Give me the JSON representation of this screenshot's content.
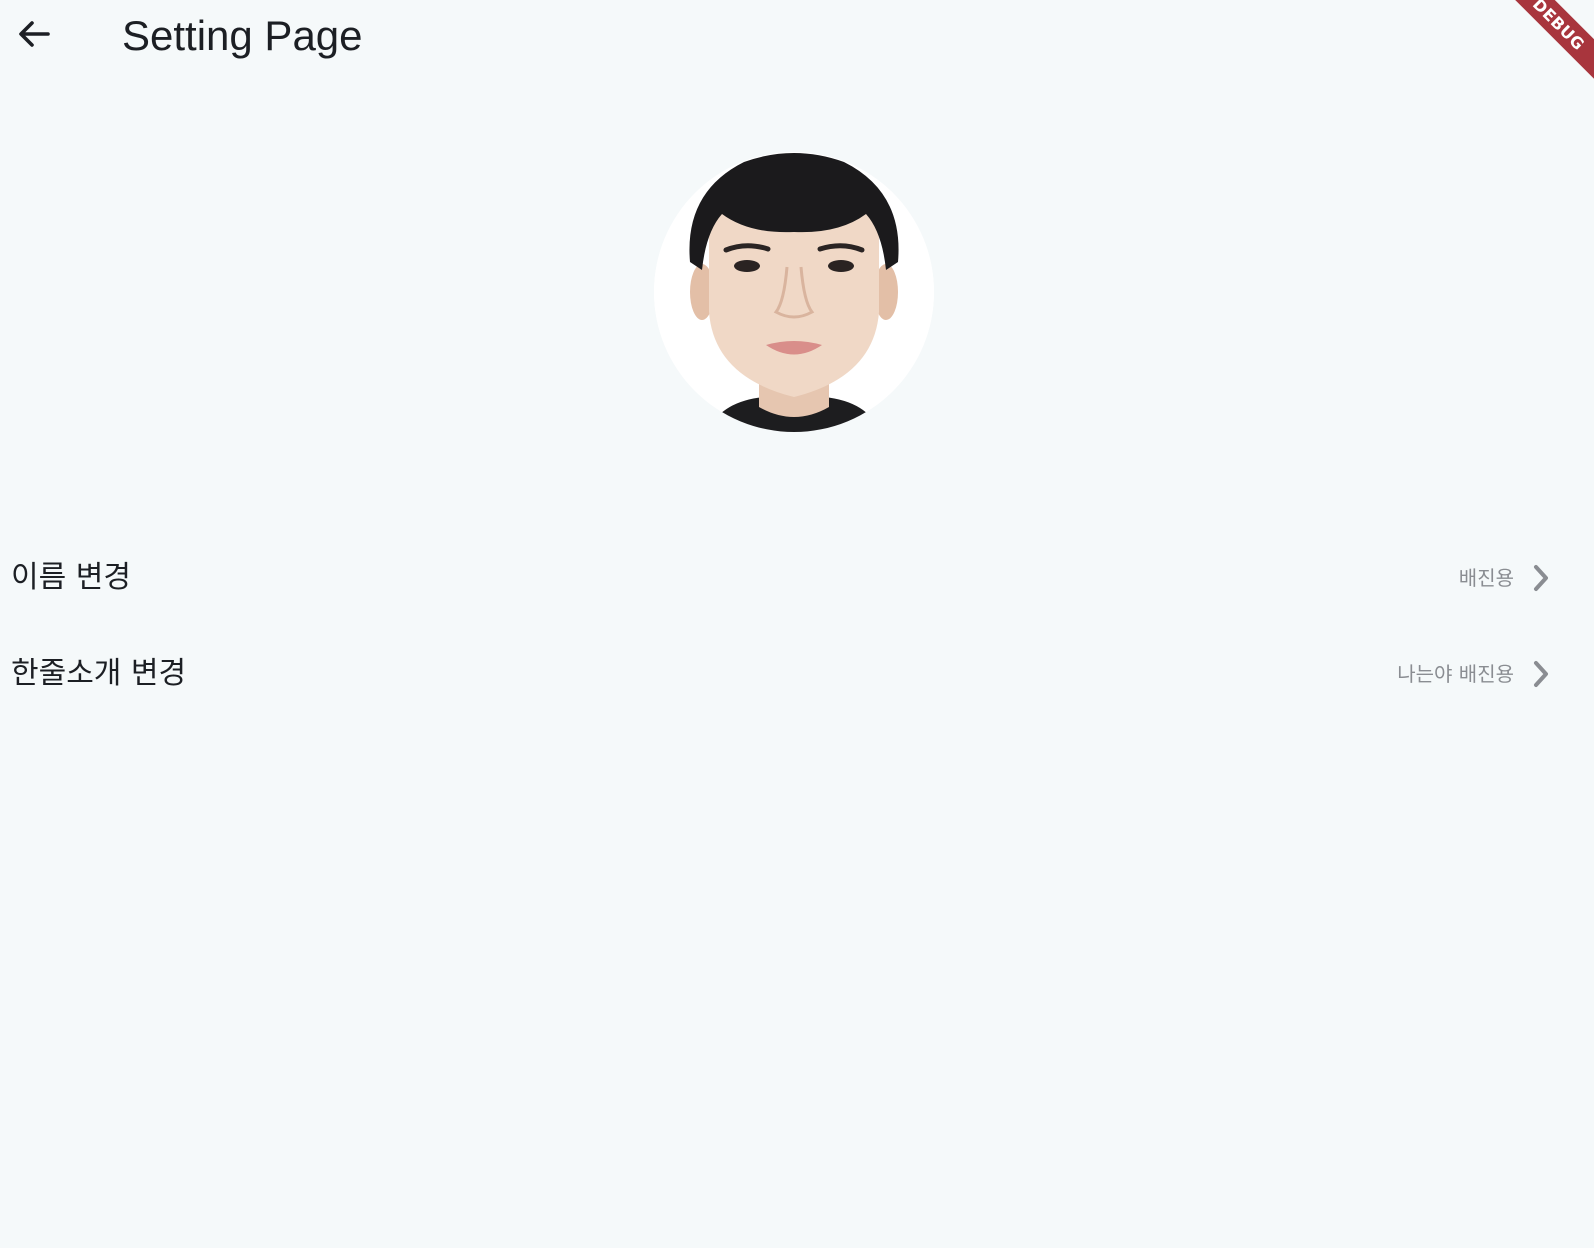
{
  "app_bar": {
    "title": "Setting Page",
    "back_icon": "arrow-back-icon"
  },
  "debug_banner": {
    "label": "DEBUG",
    "color": "#a8353d"
  },
  "profile": {
    "avatar_icon": "profile-photo"
  },
  "settings": [
    {
      "label": "이름 변경",
      "value": "배진용",
      "icon": "chevron-right-icon"
    },
    {
      "label": "한줄소개 변경",
      "value": "나는야 배진용",
      "icon": "chevron-right-icon"
    }
  ],
  "colors": {
    "background": "#f5f9fa",
    "text_primary": "#1c1f24",
    "text_secondary": "#8a8d92"
  }
}
